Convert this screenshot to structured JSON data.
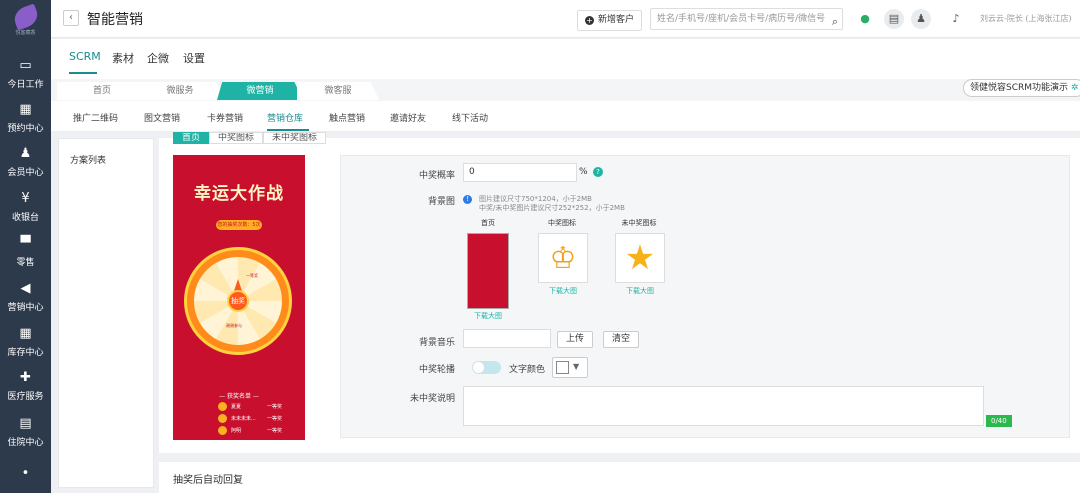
{
  "app": {
    "logo_text": "悦客藏香",
    "page_title": "智能营销",
    "back_icon": "‹"
  },
  "sidebar": {
    "items": [
      {
        "label": "今日工作",
        "icon": "monitor-icon",
        "glyph": "▭"
      },
      {
        "label": "预约中心",
        "icon": "calendar-icon",
        "glyph": "▦"
      },
      {
        "label": "会员中心",
        "icon": "users-icon",
        "glyph": "♟"
      },
      {
        "label": "收银台",
        "icon": "yen-icon",
        "glyph": "¥"
      },
      {
        "label": "零售",
        "icon": "cart-icon",
        "glyph": "🛒"
      },
      {
        "label": "营销中心",
        "icon": "megaphone-icon",
        "glyph": "📢"
      },
      {
        "label": "库存中心",
        "icon": "grid-icon",
        "glyph": "▦"
      },
      {
        "label": "医疗服务",
        "icon": "medkit-icon",
        "glyph": "✚"
      },
      {
        "label": "住院中心",
        "icon": "building-icon",
        "glyph": "▤"
      }
    ]
  },
  "header": {
    "new_customer_label": "新增客户",
    "search_placeholder": "姓名/手机号/座机/会员卡号/病历号/微信号",
    "user_label": "刘云云-院长 (上海张江店)"
  },
  "topnav": {
    "items": [
      "SCRM",
      "素材",
      "企微",
      "设置"
    ],
    "active": "SCRM"
  },
  "chevtabs": {
    "items": [
      "首页",
      "微服务",
      "微营销",
      "微客服"
    ],
    "active": "微营销",
    "demo_label": "领健悦容SCRM功能演示"
  },
  "subtabs": {
    "items": [
      "推广二维码",
      "图文营销",
      "卡券营销",
      "营销仓库",
      "触点营销",
      "邀请好友",
      "线下活动"
    ],
    "active": "营销仓库"
  },
  "plan_panel": {
    "title": "方案列表"
  },
  "inner_tabs": {
    "items": [
      "首页",
      "中奖图标",
      "未中奖图标"
    ],
    "active": "首页"
  },
  "preview": {
    "title": "幸运大作战",
    "chance_text": "您的抽奖次数：5次",
    "hub_label": "抽奖",
    "prize_1": "一等奖",
    "prize_2": "谢谢参与",
    "list_title": "— 获奖名单 —",
    "winners": [
      {
        "name": "夏夏",
        "prize": "一等奖"
      },
      {
        "name": "未未未未...",
        "prize": "一等奖"
      },
      {
        "name": "阿明",
        "prize": "一等奖"
      }
    ]
  },
  "settings": {
    "win_rate_label": "中奖概率",
    "win_rate_value": "0",
    "win_rate_unit": "%",
    "bg_label": "背景图",
    "bg_hint_1": "图片建议尺寸750*1204，小于2MB",
    "bg_hint_2": "中奖/未中奖图片建议尺寸252*252，小于2MB",
    "images": [
      {
        "caption": "首页",
        "link": "下载大图"
      },
      {
        "caption": "中奖图标",
        "link": "下载大图"
      },
      {
        "caption": "未中奖图标",
        "link": "下载大图"
      }
    ],
    "music_label": "背景音乐",
    "upload_label": "上传",
    "clear_label": "清空",
    "carousel_label": "中奖轮播",
    "text_color_label": "文字颜色",
    "no_win_label": "未中奖说明",
    "counter": "0/40"
  },
  "bottom": {
    "title": "抽奖后自动回复"
  },
  "colors": {
    "accent": "#1fb3a6",
    "sidebar_bg": "#2d3a4b",
    "preview_bg": "#c8102e"
  }
}
